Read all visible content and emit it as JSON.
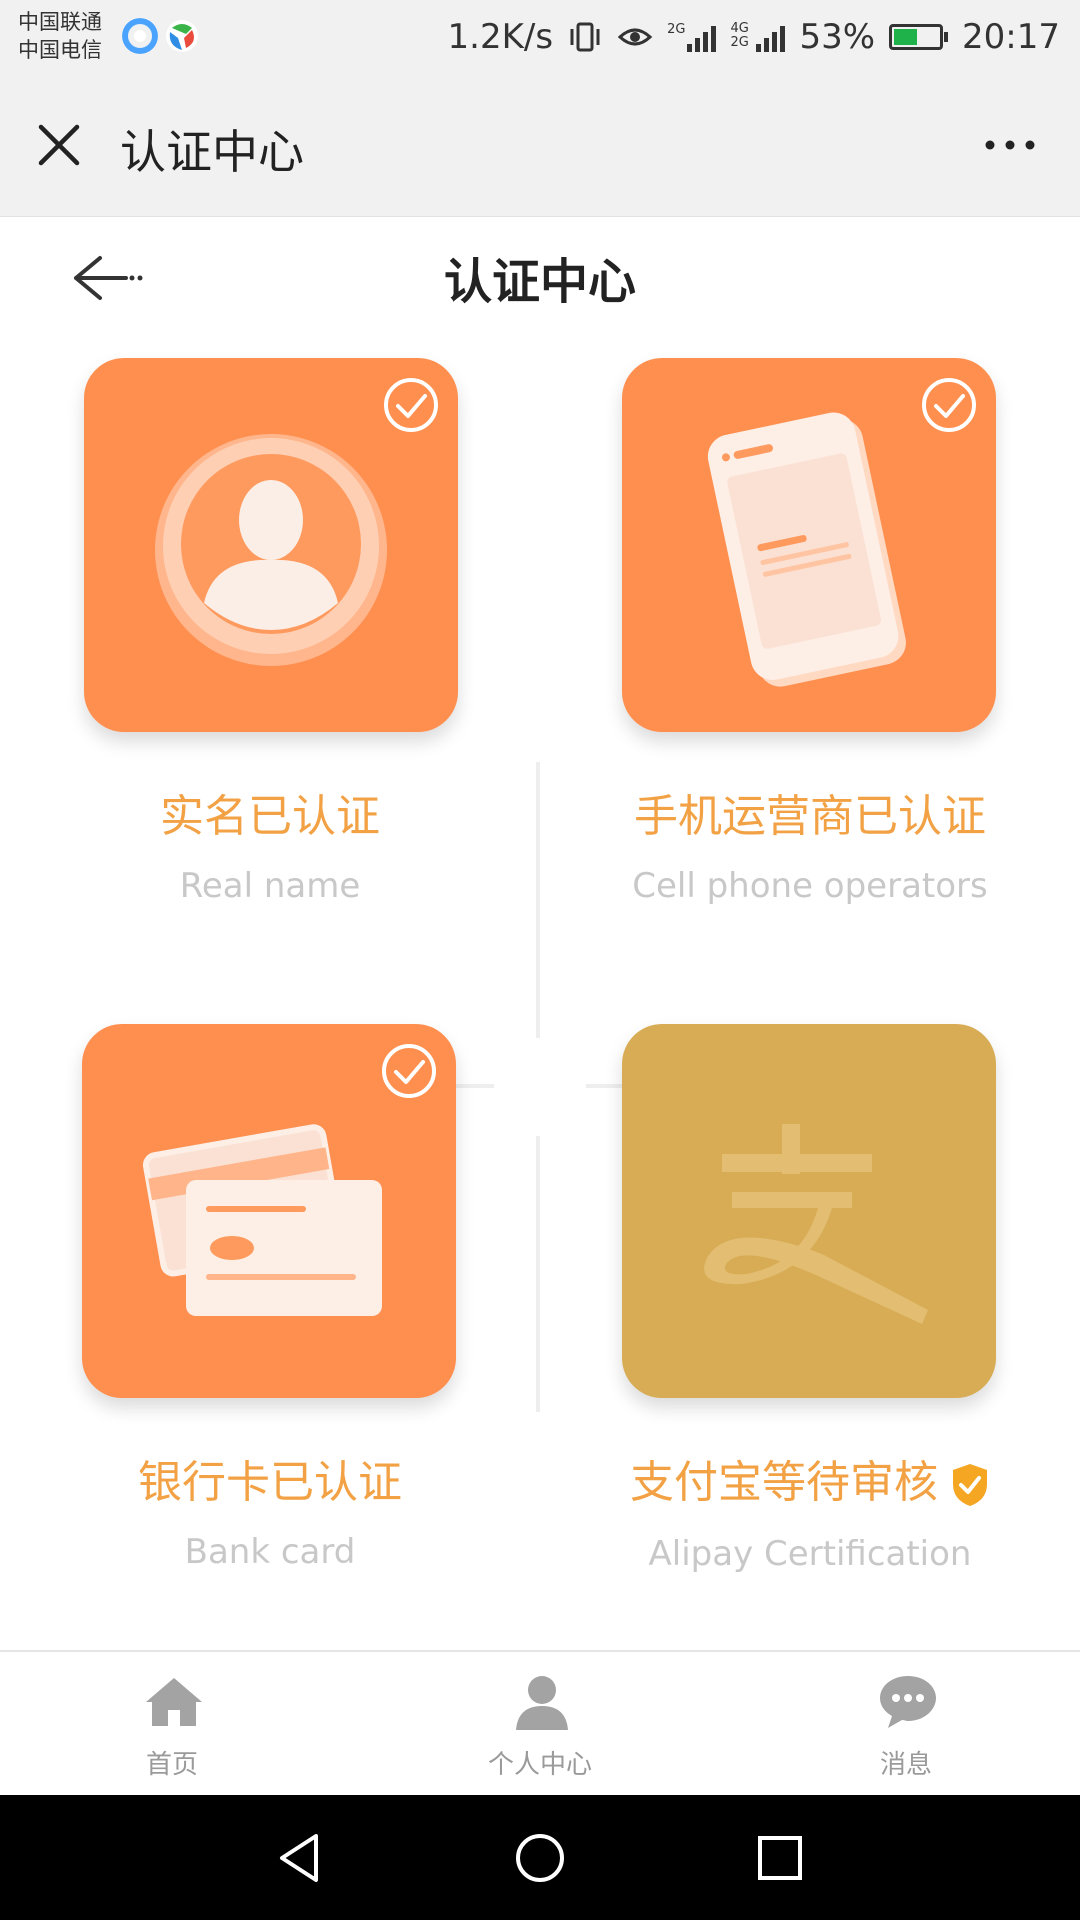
{
  "status_bar": {
    "carrier_1": "中国联通",
    "carrier_2": "中国电信",
    "net_speed": "1.2K/s",
    "sim1_type": "2G",
    "sim2_type": "4G 2G",
    "battery": "53%",
    "time": "20:17"
  },
  "app_bar": {
    "title": "认证中心",
    "close_icon": "close-icon",
    "more_icon": "more-dots-icon"
  },
  "page": {
    "title": "认证中心",
    "back_icon": "back-arrow-icon"
  },
  "cards": [
    {
      "title": "实名已认证",
      "subtitle": "Real name",
      "icon": "person-avatar-icon",
      "verified": true
    },
    {
      "title": "手机运营商已认证",
      "subtitle": "Cell phone operators",
      "icon": "smartphone-icon",
      "verified": true
    },
    {
      "title": "银行卡已认证",
      "subtitle": "Bank card",
      "icon": "bank-card-icon",
      "verified": true
    },
    {
      "title": "支付宝等待审核",
      "subtitle": "Alipay Certification",
      "icon": "alipay-icon",
      "verified": false,
      "status_icon": "shield-check-icon"
    }
  ],
  "colors": {
    "card_orange": "#ff8f4f",
    "card_gold": "#d8ac55",
    "label_orange": "#f2a144",
    "subtitle_gray": "#c8c8c8"
  },
  "tab_bar": {
    "items": [
      {
        "label": "首页",
        "icon": "home-icon"
      },
      {
        "label": "个人中心",
        "icon": "user-icon"
      },
      {
        "label": "消息",
        "icon": "chat-bubble-icon"
      }
    ]
  },
  "system_nav": [
    "back-triangle-icon",
    "home-circle-icon",
    "recents-square-icon"
  ]
}
